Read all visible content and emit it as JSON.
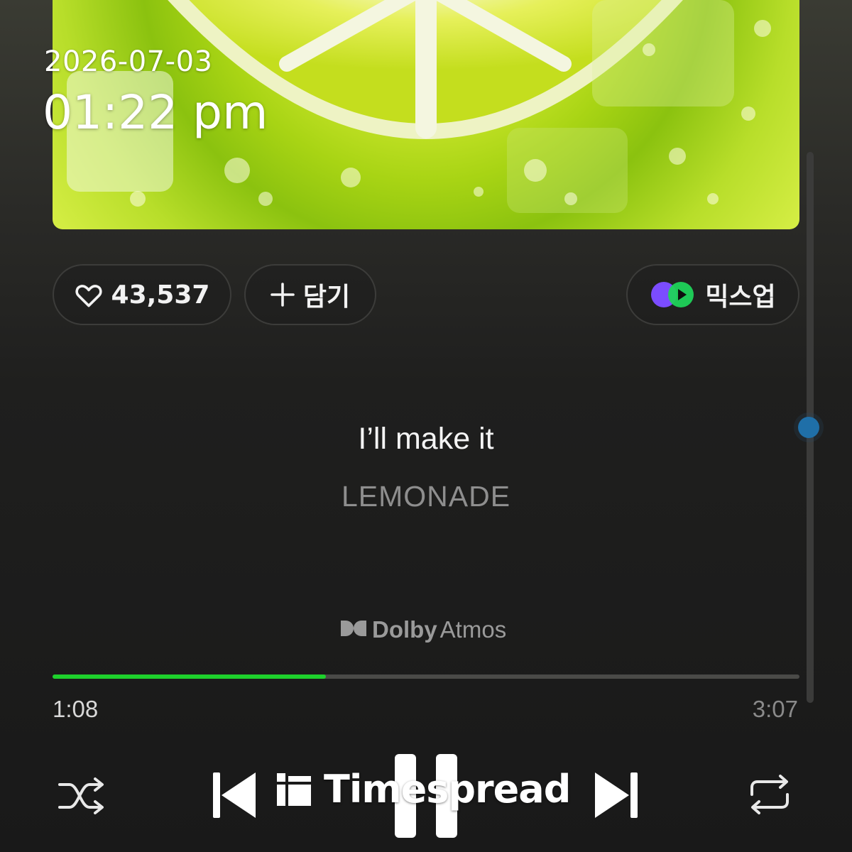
{
  "overlay": {
    "date": "2026-07-03",
    "time": "01:22 pm"
  },
  "actions": {
    "like_count": "43,537",
    "add_label": "담기",
    "mixup_label": "믹스업"
  },
  "song": {
    "title": "I’ll make it",
    "artist": "LEMONADE"
  },
  "dolby": {
    "brand": "Dolby",
    "sub": "Atmos"
  },
  "playback": {
    "elapsed": "1:08",
    "total": "3:07",
    "progress_fraction": 0.366
  },
  "watermark": {
    "text": "Timespread"
  },
  "icons": {
    "like": "heart-icon",
    "add": "plus-icon",
    "mixup": "mixup-icon",
    "dolby": "dolby-logo-icon",
    "shuffle": "shuffle-icon",
    "prev": "skip-previous-icon",
    "pause": "pause-icon",
    "next": "skip-next-icon",
    "repeat": "repeat-icon"
  },
  "colors": {
    "progress": "#1ed12c",
    "scroll_thumb": "#1f6fa8",
    "mixup_purple": "#7b4cff",
    "mixup_green": "#1fd35a"
  }
}
